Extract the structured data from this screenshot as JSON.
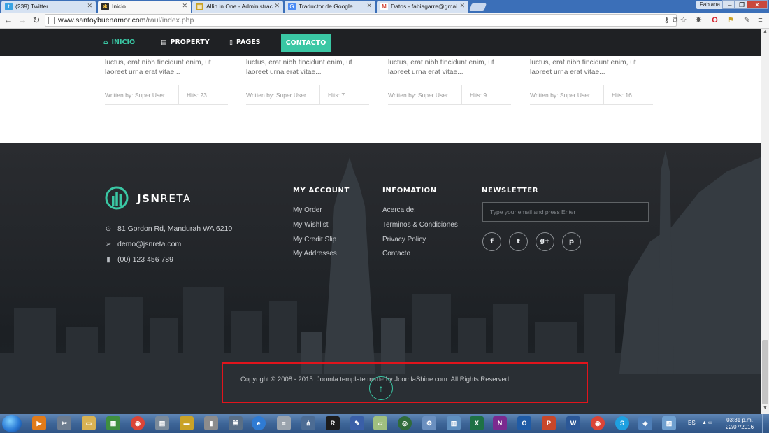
{
  "browser": {
    "tabs": [
      {
        "label": "(239) Twitter",
        "favicon": "twitter-icon",
        "color": "#3aa3e3",
        "active": false
      },
      {
        "label": "Inicio",
        "favicon": "joomla-icon",
        "color": "#2a2a2a",
        "active": true
      },
      {
        "label": "Allin in One - Administrac",
        "favicon": "allinone-icon",
        "color": "#c9a227",
        "active": false
      },
      {
        "label": "Traductor de Google",
        "favicon": "google-translate-icon",
        "color": "#4b8bf5",
        "active": false
      },
      {
        "label": "Datos - fabiagarre@gmai",
        "favicon": "gmail-icon",
        "color": "#d44638",
        "active": false
      }
    ],
    "user": "Fabiana",
    "url_host": "www.santoybuenamor.com",
    "url_path": "/raul/index.php"
  },
  "site": {
    "nav": {
      "inicio": "INICIO",
      "property": "PROPERTY",
      "pages": "PAGES",
      "contacto": "CONTACTO"
    },
    "articles": [
      {
        "excerpt": "luctus, erat nibh tincidunt enim, ut laoreet urna erat vitae...",
        "author": "Written by: Super User",
        "hits": "Hits: 23"
      },
      {
        "excerpt": "luctus, erat nibh tincidunt enim, ut laoreet urna erat vitae...",
        "author": "Written by: Super User",
        "hits": "Hits: 7"
      },
      {
        "excerpt": "luctus, erat nibh tincidunt enim, ut laoreet urna erat vitae...",
        "author": "Written by: Super User",
        "hits": "Hits: 9"
      },
      {
        "excerpt": "luctus, erat nibh tincidunt enim, ut laoreet urna erat vitae...",
        "author": "Written by: Super User",
        "hits": "Hits: 16"
      }
    ],
    "footer": {
      "brand_bold": "JSN",
      "brand_light": "RETA",
      "address": "81 Gordon Rd, Mandurah WA 6210",
      "email": "demo@jsnreta.com",
      "phone": "(00) 123 456 789",
      "my_account": {
        "title": "MY ACCOUNT",
        "links": [
          "My Order",
          "My Wishlist",
          "My Credit Slip",
          "My Addresses"
        ]
      },
      "information": {
        "title": "INFOMATION",
        "links": [
          "Acerca de:",
          "Terminos & Condiciones",
          "Privacy Policy",
          "Contacto"
        ]
      },
      "newsletter": {
        "title": "NEWSLETTER",
        "placeholder": "Type your email and press Enter",
        "social": [
          "f",
          "t",
          "g+",
          "p"
        ]
      },
      "copyright": "Copyright © 2008 - 2015. Joomla template made by JoomlaShine.com. All Rights Reserved."
    },
    "accent_color": "#3ac7a4"
  },
  "taskbar": {
    "language": "ES",
    "time": "03:31 p.m.",
    "date": "22/07/2016"
  }
}
